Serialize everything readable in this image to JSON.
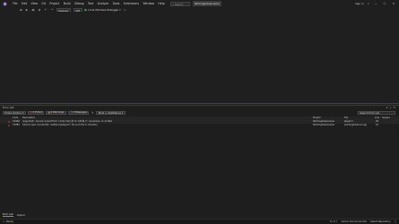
{
  "titlebar": {
    "menus": [
      "File",
      "Edit",
      "View",
      "Git",
      "Project",
      "Build",
      "Debug",
      "Test",
      "Analyze",
      "Tools",
      "Extensions",
      "Window",
      "Help"
    ],
    "search_label": "Search",
    "solution_name": "WorkingAdvanceme",
    "signin_label": "Sign in",
    "minimize": "—",
    "maximize": "☐",
    "close": "✕"
  },
  "toolbar": {
    "config": "Release",
    "platform": "x64",
    "run_label": "Local Windows Debugger"
  },
  "panel": {
    "title": "Error List",
    "scope": "Entire Solution",
    "errors_label": "2 Errors",
    "warnings_label": "0 Warnings",
    "messages_label": "0 Messages",
    "build_filter": "Build + IntelliSense",
    "search_placeholder": "Search Error List",
    "columns": {
      "code": "Code",
      "description": "Description",
      "project": "Project",
      "file": "File",
      "line": "Line",
      "state": "Suppre"
    },
    "rows": [
      {
        "code": "C2440",
        "description": "'argument': cannot convert from 'const char [4]' to 'LPCW_T', conversion on of data",
        "project": "WorkingAdvanceme",
        "file": "player.h",
        "line": "26"
      },
      {
        "code": "C1083",
        "description": "Cannot open include file: 'ssoft/incs/player.h'; No such file or directory",
        "project": "WorkingAdvanceme",
        "file": "workingAdvance.cpp",
        "line": "12"
      }
    ],
    "tabs": [
      "Error List",
      "Output"
    ]
  },
  "status": {
    "ready": "Ready",
    "add_source": "Add to Source Control",
    "lines": "0 / 0 ↑",
    "select_repo": "Select Repository"
  }
}
